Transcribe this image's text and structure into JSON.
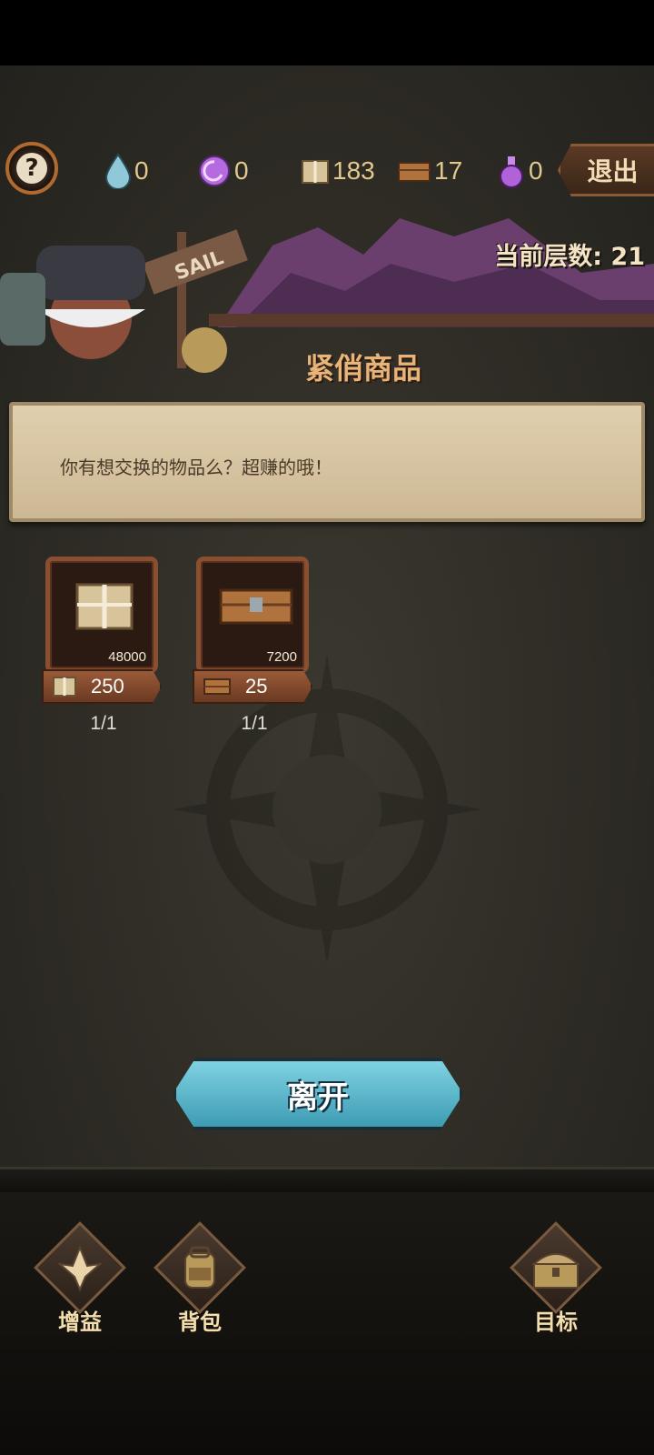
{
  "resources": {
    "help_label": "?",
    "drop": "0",
    "swirl": "0",
    "parcel": "183",
    "crate": "17",
    "potion": "0",
    "exit_label": "退出"
  },
  "scene": {
    "floor_text": "当前层数: 21",
    "sign_text": "SAIL",
    "shop_title": "紧俏商品"
  },
  "dialog": {
    "text": "你有想交换的物品么？超赚的哦！"
  },
  "items": [
    {
      "icon": "parcel-icon",
      "count": "48000",
      "price": "250",
      "stock": "1/1"
    },
    {
      "icon": "crate-icon",
      "count": "7200",
      "price": "25",
      "stock": "1/1"
    }
  ],
  "leave_label": "离开",
  "nav": {
    "buff": "增益",
    "bag": "背包",
    "goal": "目标"
  },
  "colors": {
    "accent_gold": "#e3c98d",
    "leave_button": "#5bb8cc",
    "shop_title": "#e8b478"
  }
}
